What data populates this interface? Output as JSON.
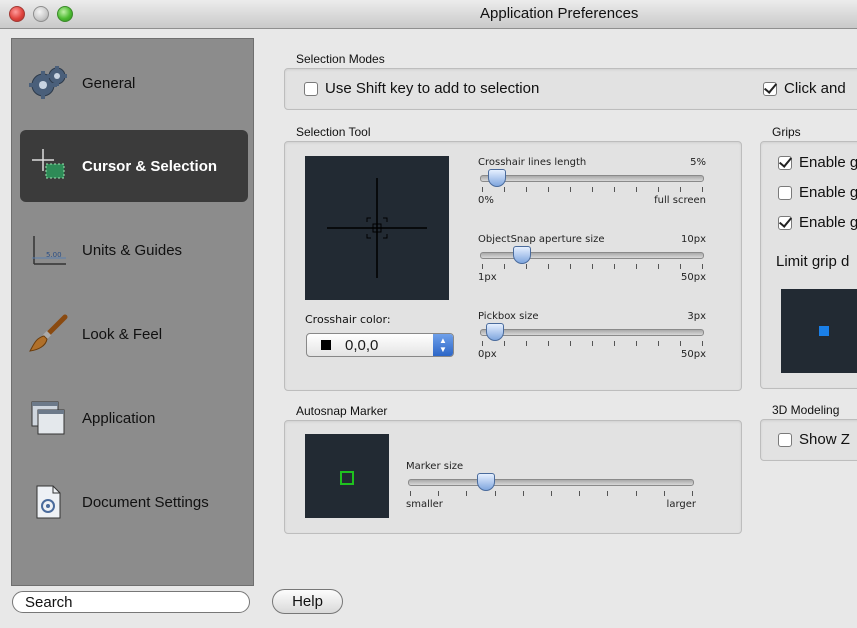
{
  "window": {
    "title": "Application Preferences"
  },
  "sidebar": {
    "items": [
      {
        "label": "General",
        "icon": "gears-icon"
      },
      {
        "label": "Cursor & Selection",
        "icon": "crosshair-icon",
        "selected": true
      },
      {
        "label": "Units & Guides",
        "icon": "ruler-icon"
      },
      {
        "label": "Look & Feel",
        "icon": "paintbrush-icon"
      },
      {
        "label": "Application",
        "icon": "windows-icon"
      },
      {
        "label": "Document Settings",
        "icon": "document-icon"
      }
    ],
    "search_label": "Search"
  },
  "selection_modes": {
    "label": "Selection Modes",
    "use_shift": {
      "label": "Use Shift key to add to selection",
      "checked": false
    },
    "click_and": {
      "label": "Click and",
      "checked": true
    }
  },
  "selection_tool": {
    "label": "Selection Tool",
    "crosshair_color_label": "Crosshair color:",
    "crosshair_color_value": "0,0,0",
    "crosshair_swatch": "#000000",
    "sliders": [
      {
        "title": "Crosshair lines length",
        "value": "5%",
        "min": "0%",
        "max": "full screen",
        "position": 0.07
      },
      {
        "title": "ObjectSnap aperture size",
        "value": "10px",
        "min": "1px",
        "max": "50px",
        "position": 0.18
      },
      {
        "title": "Pickbox size",
        "value": "3px",
        "min": "0px",
        "max": "50px",
        "position": 0.06
      }
    ]
  },
  "autosnap": {
    "label": "Autosnap Marker",
    "slider": {
      "title": "Marker size",
      "min": "smaller",
      "max": "larger",
      "position": 0.27
    },
    "marker_color": "#1fc11f"
  },
  "grips": {
    "label": "Grips",
    "options": [
      {
        "label": "Enable g",
        "checked": true
      },
      {
        "label": "Enable g",
        "checked": false
      },
      {
        "label": "Enable g",
        "checked": true
      }
    ],
    "limit_label": "Limit grip d",
    "grip_color": "#1a7fe8"
  },
  "modeling": {
    "label": "3D Modeling",
    "show_z": {
      "label": "Show Z",
      "checked": false
    }
  },
  "buttons": {
    "help": "Help"
  },
  "colors": {
    "sidebar_bg": "#8c8c8c",
    "sidebar_selected": "#3b3b3b",
    "preview_bg": "#222a33"
  }
}
